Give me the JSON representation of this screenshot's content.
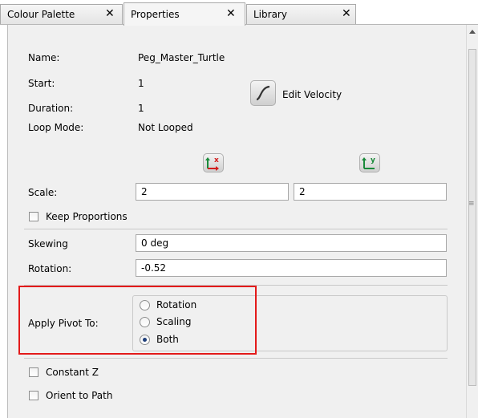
{
  "tabs": [
    {
      "label": "Colour Palette",
      "close": "✕"
    },
    {
      "label": "Properties",
      "close": "✕"
    },
    {
      "label": "Library",
      "close": "✕"
    }
  ],
  "properties": {
    "name_label": "Name:",
    "name_value": "Peg_Master_Turtle",
    "start_label": "Start:",
    "start_value": "1",
    "duration_label": "Duration:",
    "duration_value": "1",
    "loop_label": "Loop Mode:",
    "loop_value": "Not Looped",
    "edit_velocity_label": "Edit Velocity",
    "scale_label": "Scale:",
    "scale_x": "2",
    "scale_y": "2",
    "keep_proportions_label": "Keep Proportions",
    "skewing_label": "Skewing",
    "skewing_value": "0 deg",
    "rotation_label": "Rotation:",
    "rotation_value": "-0.52",
    "apply_pivot_label": "Apply Pivot To:",
    "pivot_options": [
      {
        "label": "Rotation",
        "checked": false
      },
      {
        "label": "Scaling",
        "checked": false
      },
      {
        "label": "Both",
        "checked": true
      }
    ],
    "constant_z_label": "Constant Z",
    "orient_to_path_label": "Orient to Path"
  },
  "icons": {
    "edit_velocity": "velocity-curve-icon",
    "scale_x": "scale-x-axis-icon",
    "scale_y": "scale-y-axis-icon"
  },
  "colors": {
    "highlight": "#e31a1a",
    "panel_bg": "#f0f0f0"
  }
}
